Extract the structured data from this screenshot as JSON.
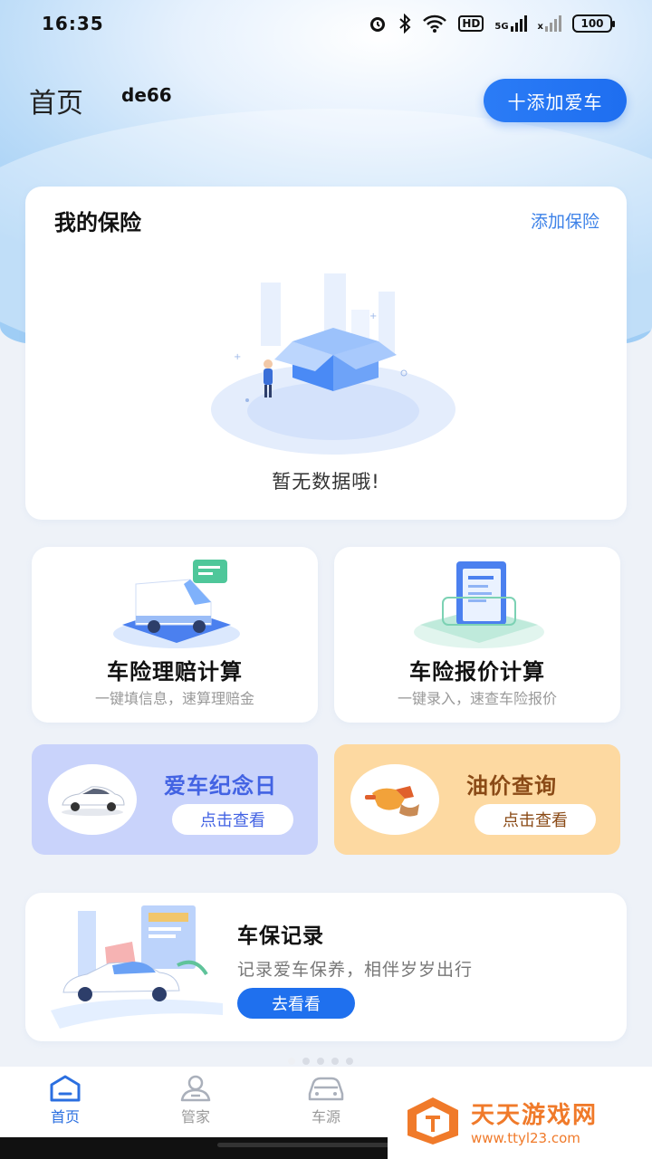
{
  "status_bar": {
    "time": "16:35",
    "battery": "100",
    "hd_label": "HD",
    "signal_label": "5G"
  },
  "header": {
    "title": "首页",
    "username": "de66",
    "add_car_label": "十添加爱车"
  },
  "insurance": {
    "title": "我的保险",
    "add_label": "添加保险",
    "empty_text": "暂无数据哦!"
  },
  "calculators": [
    {
      "title": "车险理赔计算",
      "subtitle": "一键填信息，速算理赔金"
    },
    {
      "title": "车险报价计算",
      "subtitle": "一键录入，速查车险报价"
    }
  ],
  "features": [
    {
      "title": "爱车纪念日",
      "button": "点击查看"
    },
    {
      "title": "油价查询",
      "button": "点击查看"
    }
  ],
  "record": {
    "title": "车保记录",
    "subtitle": "记录爱车保养，相伴岁岁出行",
    "button": "去看看"
  },
  "tabs": [
    {
      "label": "首页",
      "icon": "home-icon",
      "active": true
    },
    {
      "label": "管家",
      "icon": "person-icon",
      "active": false
    },
    {
      "label": "车源",
      "icon": "car-icon",
      "active": false
    }
  ],
  "watermark": {
    "name": "天天游戏网",
    "url": "www.ttyl23.com"
  },
  "colors": {
    "primary": "#1f70ee",
    "feature_blue": "#c9d3fb",
    "feature_orange": "#fdd9a1",
    "watermark": "#f07a2a"
  }
}
